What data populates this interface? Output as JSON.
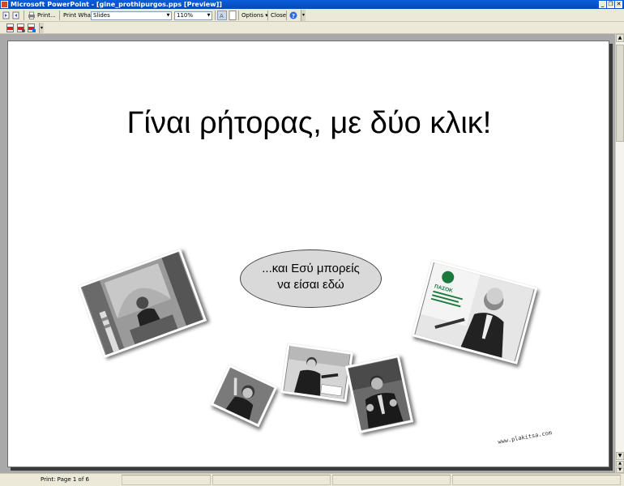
{
  "window": {
    "title": "Microsoft PowerPoint - [gine_prothipurgos.pps [Preview]]",
    "buttons": {
      "minimize": "_",
      "restore": "❐",
      "close": "✕"
    }
  },
  "toolbar": {
    "print_label": "Print...",
    "print_what_label": "Print What:",
    "print_what_value": "Slides",
    "zoom_value": "110%",
    "options_label": "Options ▾",
    "close_label": "Close"
  },
  "slide": {
    "title": "Γίναι ρήτορας, με δύο κλικ!",
    "callout_line1": "...και Εσύ μπορείς",
    "callout_line2": "να είσαι  εδώ",
    "photo_sign_text": "ΠΑΣΟΚ",
    "credit": "www.plakitsa.com"
  },
  "status": {
    "page_text": "Print: Page 1 of 6"
  },
  "colors": {
    "titlebar": "#0548b8",
    "chrome": "#ece9d8",
    "workspace": "#a9a9a9",
    "callout_fill": "#d9d9d9",
    "pasok_green": "#1a7a3c"
  }
}
